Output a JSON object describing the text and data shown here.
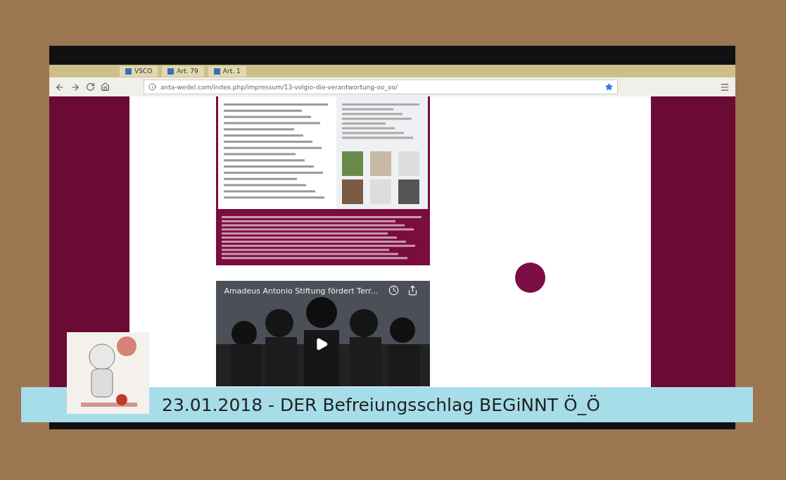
{
  "browser": {
    "tabs": [
      {
        "label": "VSCO"
      },
      {
        "label": "Art. 79"
      },
      {
        "label": "Art. 1"
      }
    ],
    "url": "anta-wedel.com/index.php/impressum/13-volgio-die-verantwortung-oo_oo/",
    "video": {
      "title": "Amadeus Antonio Stiftung fördert Terr..."
    }
  },
  "caption": {
    "text": "23.01.2018 - DER Befreiungsschlag BEGiNNT Ö_Ö"
  }
}
